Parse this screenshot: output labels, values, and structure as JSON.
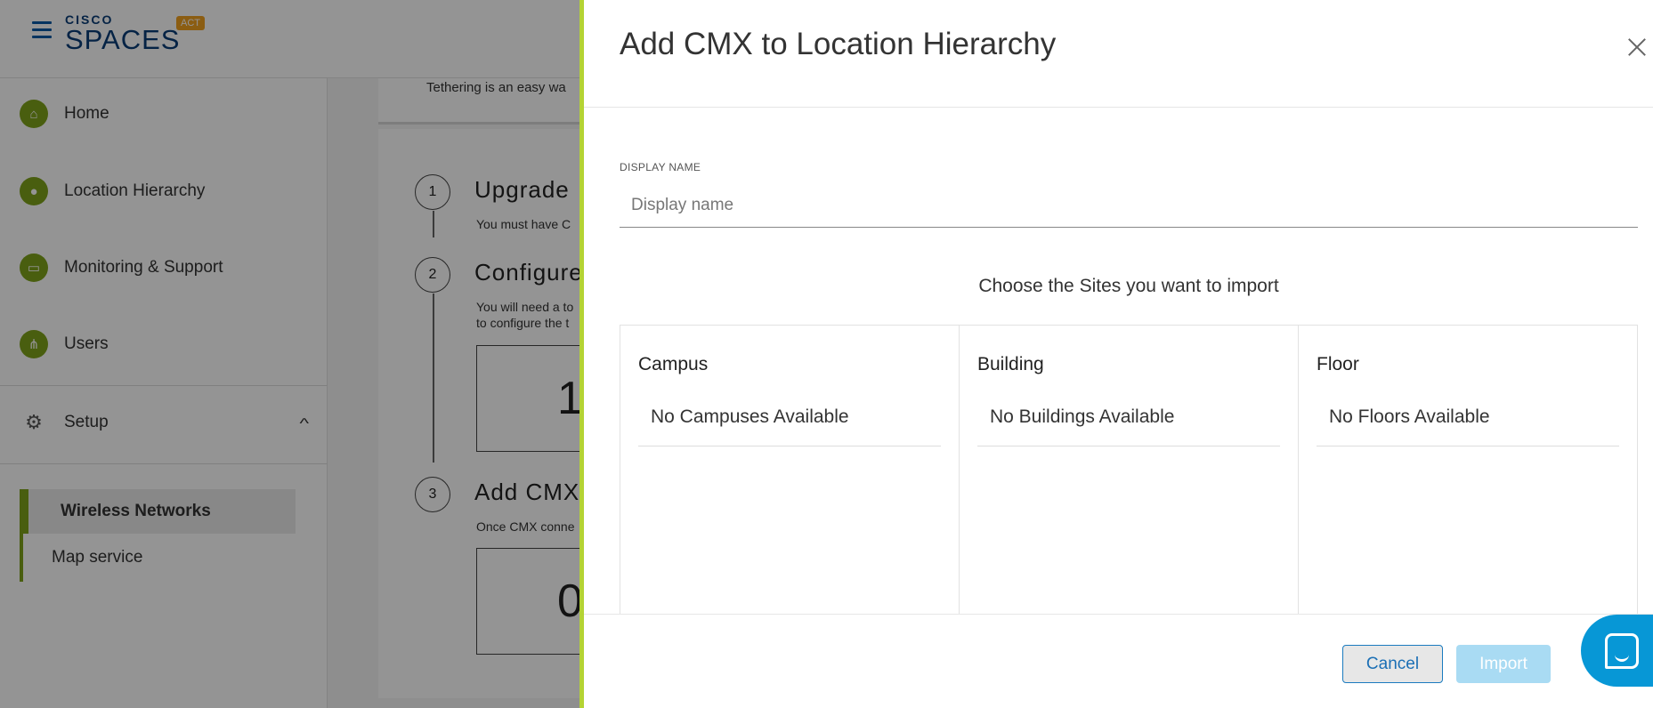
{
  "app": {
    "brand_top": "CISCO",
    "brand_main": "SPACES",
    "badge": "ACT"
  },
  "sidebar": {
    "items": [
      {
        "label": "Home",
        "icon": "home-icon"
      },
      {
        "label": "Location Hierarchy",
        "icon": "location-pin-icon"
      },
      {
        "label": "Monitoring & Support",
        "icon": "monitor-icon"
      },
      {
        "label": "Users",
        "icon": "users-icon"
      },
      {
        "label": "Setup",
        "icon": "gear-icon"
      }
    ],
    "submenu": [
      "Wireless Networks",
      "Map service"
    ]
  },
  "background": {
    "intro": "Tethering is an easy wa",
    "steps": [
      {
        "num": "1",
        "title": "Upgrade",
        "desc": "You must have C"
      },
      {
        "num": "2",
        "title": "Configure",
        "desc1": "You will need a to",
        "desc2": "to configure the t",
        "box": "1"
      },
      {
        "num": "3",
        "title": "Add CMX",
        "desc": "Once CMX conne",
        "box": "0"
      }
    ]
  },
  "drawer": {
    "title": "Add CMX to Location Hierarchy",
    "field_label": "DISPLAY NAME",
    "field_placeholder": "Display name",
    "field_value": "",
    "choose_text": "Choose the Sites you want to import",
    "columns": [
      {
        "header": "Campus",
        "empty": "No Campuses Available"
      },
      {
        "header": "Building",
        "empty": "No Buildings Available"
      },
      {
        "header": "Floor",
        "empty": "No Floors Available"
      }
    ],
    "cancel_label": "Cancel",
    "import_label": "Import"
  },
  "colors": {
    "accent_green": "#7ea31b",
    "drawer_border": "#b4d334",
    "primary_blue": "#1b7bbf",
    "import_disabled": "#a9dbf3",
    "chat_blue": "#0797d6"
  }
}
